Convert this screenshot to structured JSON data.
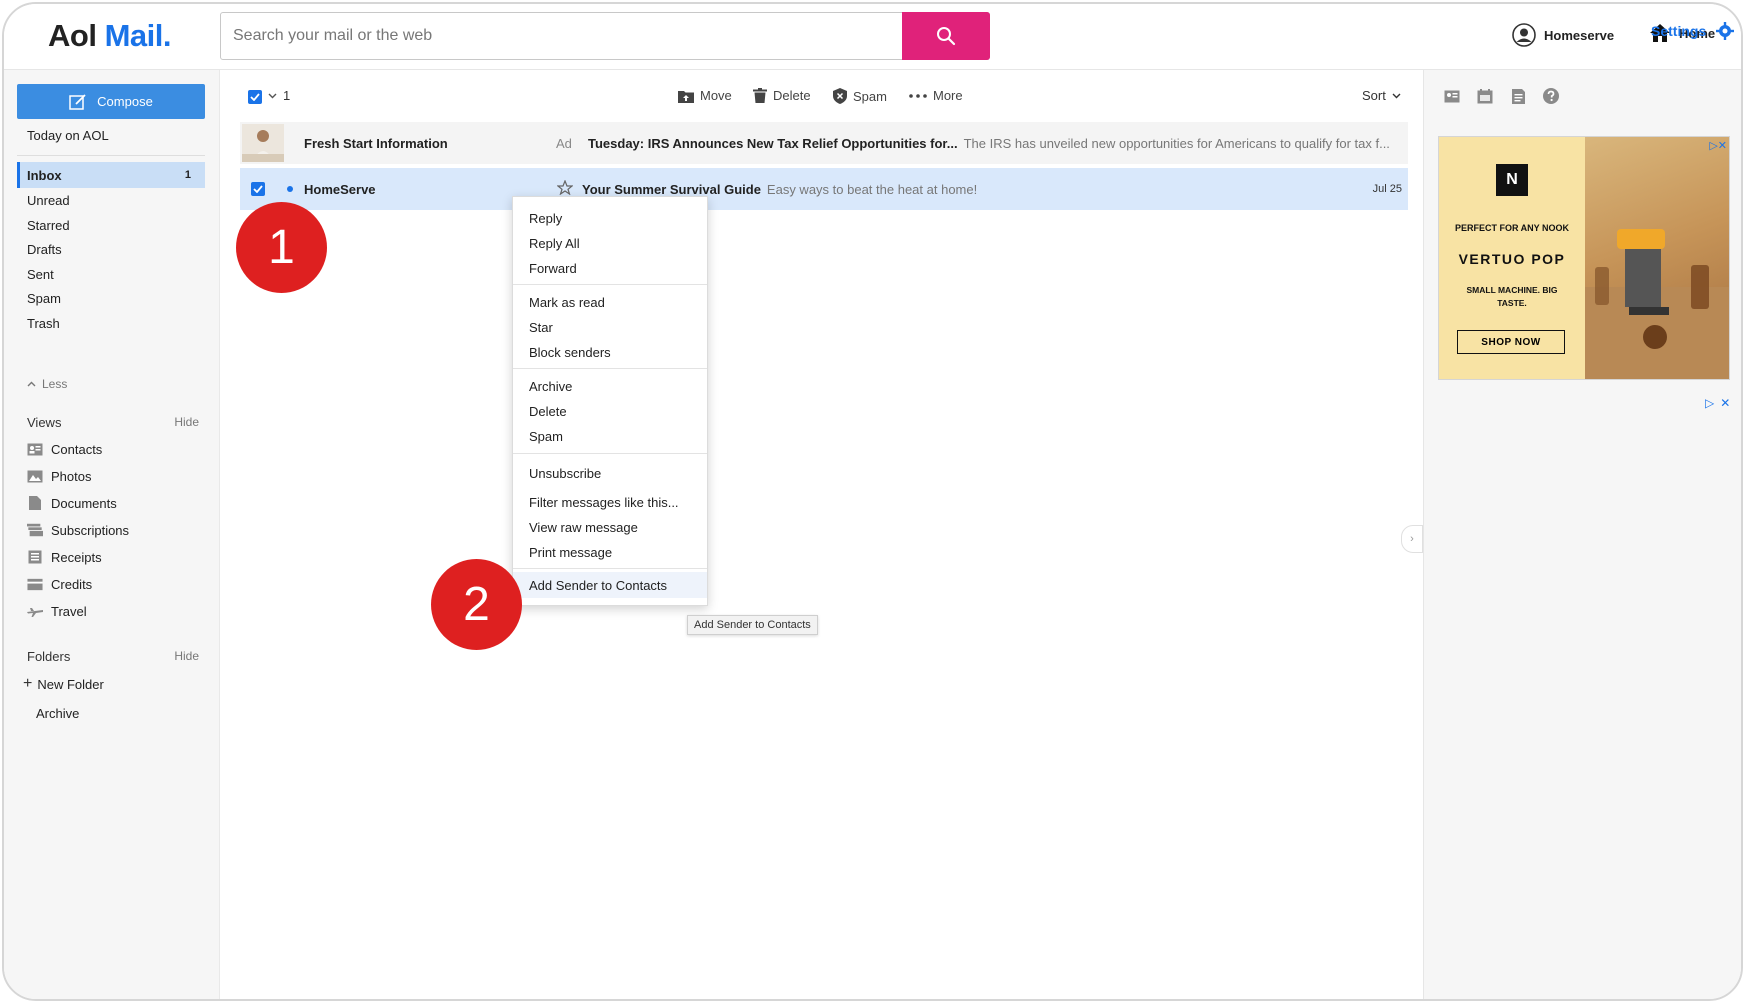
{
  "header": {
    "logo_aol": "Aol",
    "logo_mail": "Mail.",
    "search_placeholder": "Search your mail or the web",
    "account_name": "Homeserve",
    "home_label": "Home"
  },
  "sidebar": {
    "compose_label": "Compose",
    "today": "Today on AOL",
    "folders": [
      {
        "label": "Inbox",
        "count": "1"
      },
      {
        "label": "Unread"
      },
      {
        "label": "Starred"
      },
      {
        "label": "Drafts"
      },
      {
        "label": "Sent"
      },
      {
        "label": "Spam"
      },
      {
        "label": "Trash"
      }
    ],
    "less_label": "Less",
    "views_title": "Views",
    "views_hide": "Hide",
    "views": [
      "Contacts",
      "Photos",
      "Documents",
      "Subscriptions",
      "Receipts",
      "Credits",
      "Travel"
    ],
    "folders_title": "Folders",
    "folders_hide": "Hide",
    "new_folder": "New Folder",
    "archive": "Archive"
  },
  "toolbar": {
    "selected_count": "1",
    "move": "Move",
    "delete": "Delete",
    "spam": "Spam",
    "more": "More",
    "sort": "Sort"
  },
  "messages": [
    {
      "sender": "Fresh Start Information",
      "ad_label": "Ad",
      "subject": "Tuesday: IRS Announces New Tax Relief Opportunities for...",
      "snippet": "The IRS has unveiled new opportunities for Americans to qualify for tax f..."
    },
    {
      "sender": "HomeServe",
      "subject": "Your Summer Survival Guide",
      "snippet": "Easy ways to beat the heat at home!",
      "date": "Jul 25"
    }
  ],
  "context_menu": {
    "reply": "Reply",
    "reply_all": "Reply All",
    "forward": "Forward",
    "mark_read": "Mark as read",
    "star": "Star",
    "block": "Block senders",
    "archive": "Archive",
    "delete": "Delete",
    "spam": "Spam",
    "unsubscribe": "Unsubscribe",
    "filter": "Filter messages like this...",
    "view_raw": "View raw message",
    "print": "Print message",
    "add_contact": "Add Sender to Contacts"
  },
  "tooltip": "Add Sender to Contacts",
  "markers": {
    "one": "1",
    "two": "2"
  },
  "right_panel": {
    "settings_label": "Settings",
    "ad": {
      "brand": "N",
      "tagline": "PERFECT FOR ANY NOOK",
      "product": "VERTUO POP",
      "subtext": "SMALL MACHINE. BIG TASTE.",
      "cta": "SHOP NOW"
    }
  },
  "colors": {
    "accent": "#1a73e8",
    "search_button": "#e0227a",
    "compose": "#3b8de1",
    "selected_row": "#d9e8fb",
    "marker": "#de2020"
  }
}
